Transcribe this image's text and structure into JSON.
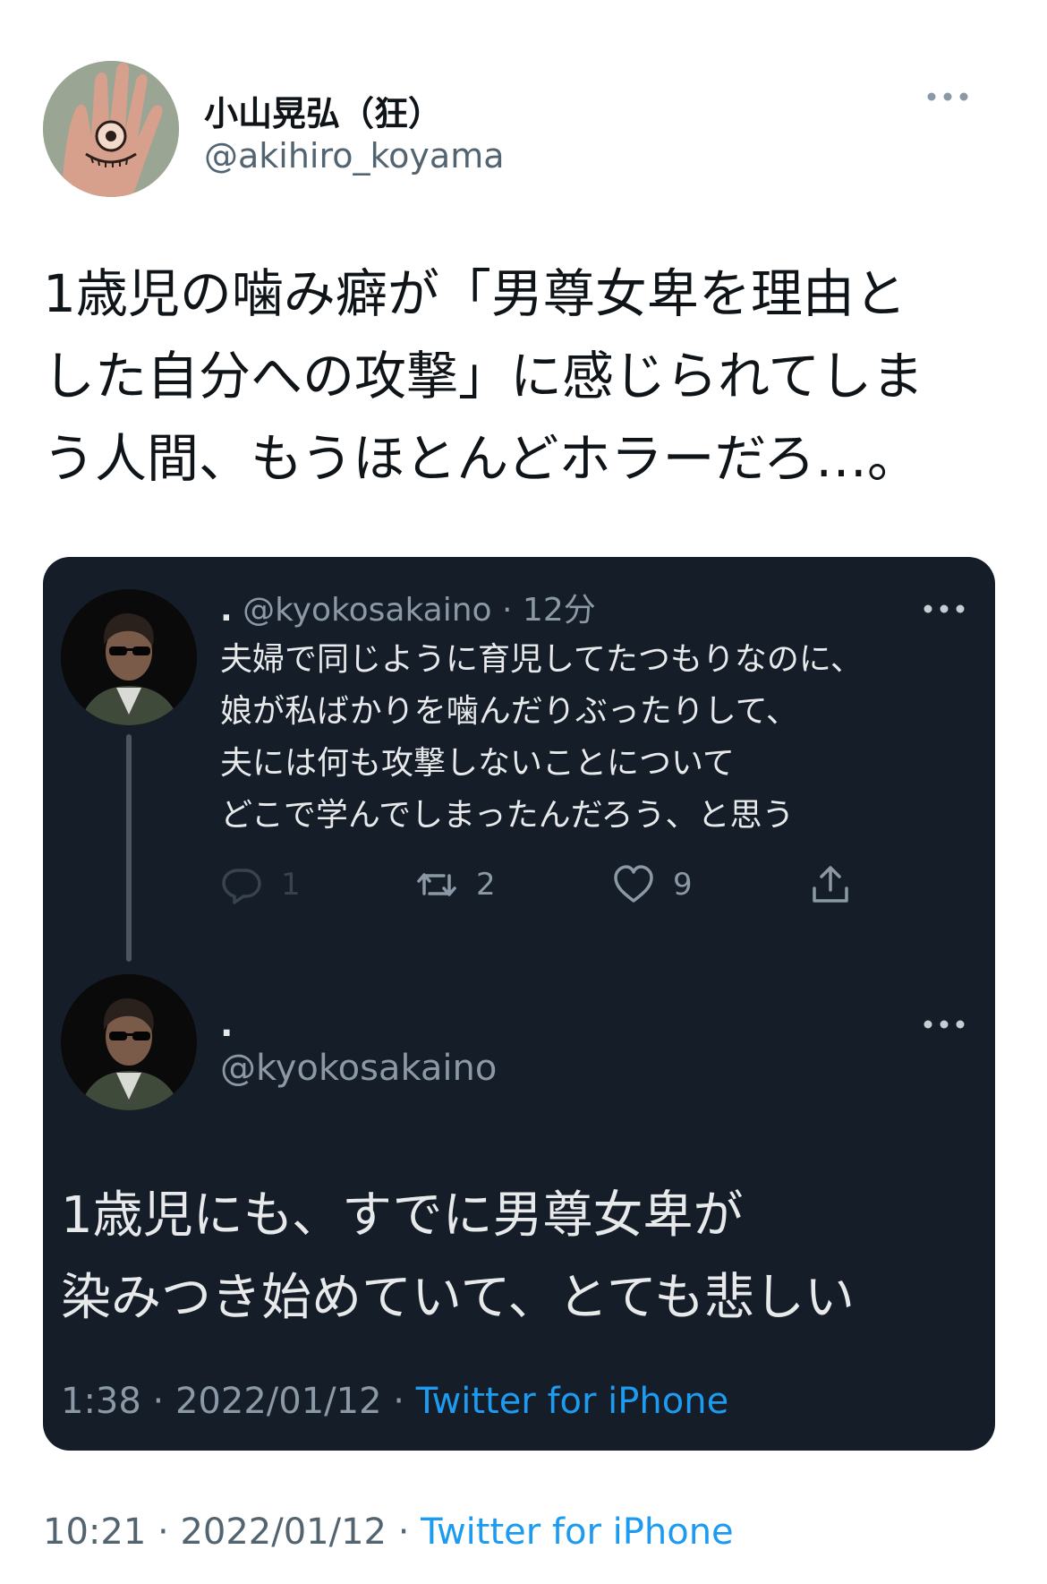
{
  "tweet": {
    "author_name": "小山晃弘（狂）",
    "author_handle": "@akihiro_koyama",
    "text": "1歳児の噛み癖が「男尊女卑を理由と\nした自分への攻撃」に感じられてしま\nう人間、もうほとんどホラーだろ…。",
    "time": "10:21",
    "date": "2022/01/12",
    "separator": "·",
    "source": "Twitter for iPhone",
    "more_icon": "more-horizontal-icon"
  },
  "quoted": {
    "card_color": "#151d29",
    "first": {
      "name": ".",
      "handle": "@kyokosakaino",
      "age": "12分",
      "separator": "·",
      "text": "夫婦で同じように育児してたつもりなのに、\n娘が私ばかりを噛んだりぶったりして、\n夫には何も攻撃しないことについて\nどこで学んでしまったんだろう、と思う",
      "actions": {
        "reply_count": "1",
        "retweet_count": "2",
        "like_count": "9",
        "icons": [
          "reply-icon",
          "retweet-icon",
          "like-icon",
          "share-icon"
        ]
      }
    },
    "second": {
      "name": ".",
      "handle": "@kyokosakaino",
      "text": "1歳児にも、すでに男尊女卑が\n染みつき始めていて、とても悲しい",
      "time": "1:38",
      "date": "2022/01/12",
      "separator": "·",
      "source": "Twitter for iPhone"
    }
  },
  "colors": {
    "accent": "#1d9bf0",
    "secondary_text": "#536471",
    "dark_secondary_text": "#8b98a5"
  }
}
